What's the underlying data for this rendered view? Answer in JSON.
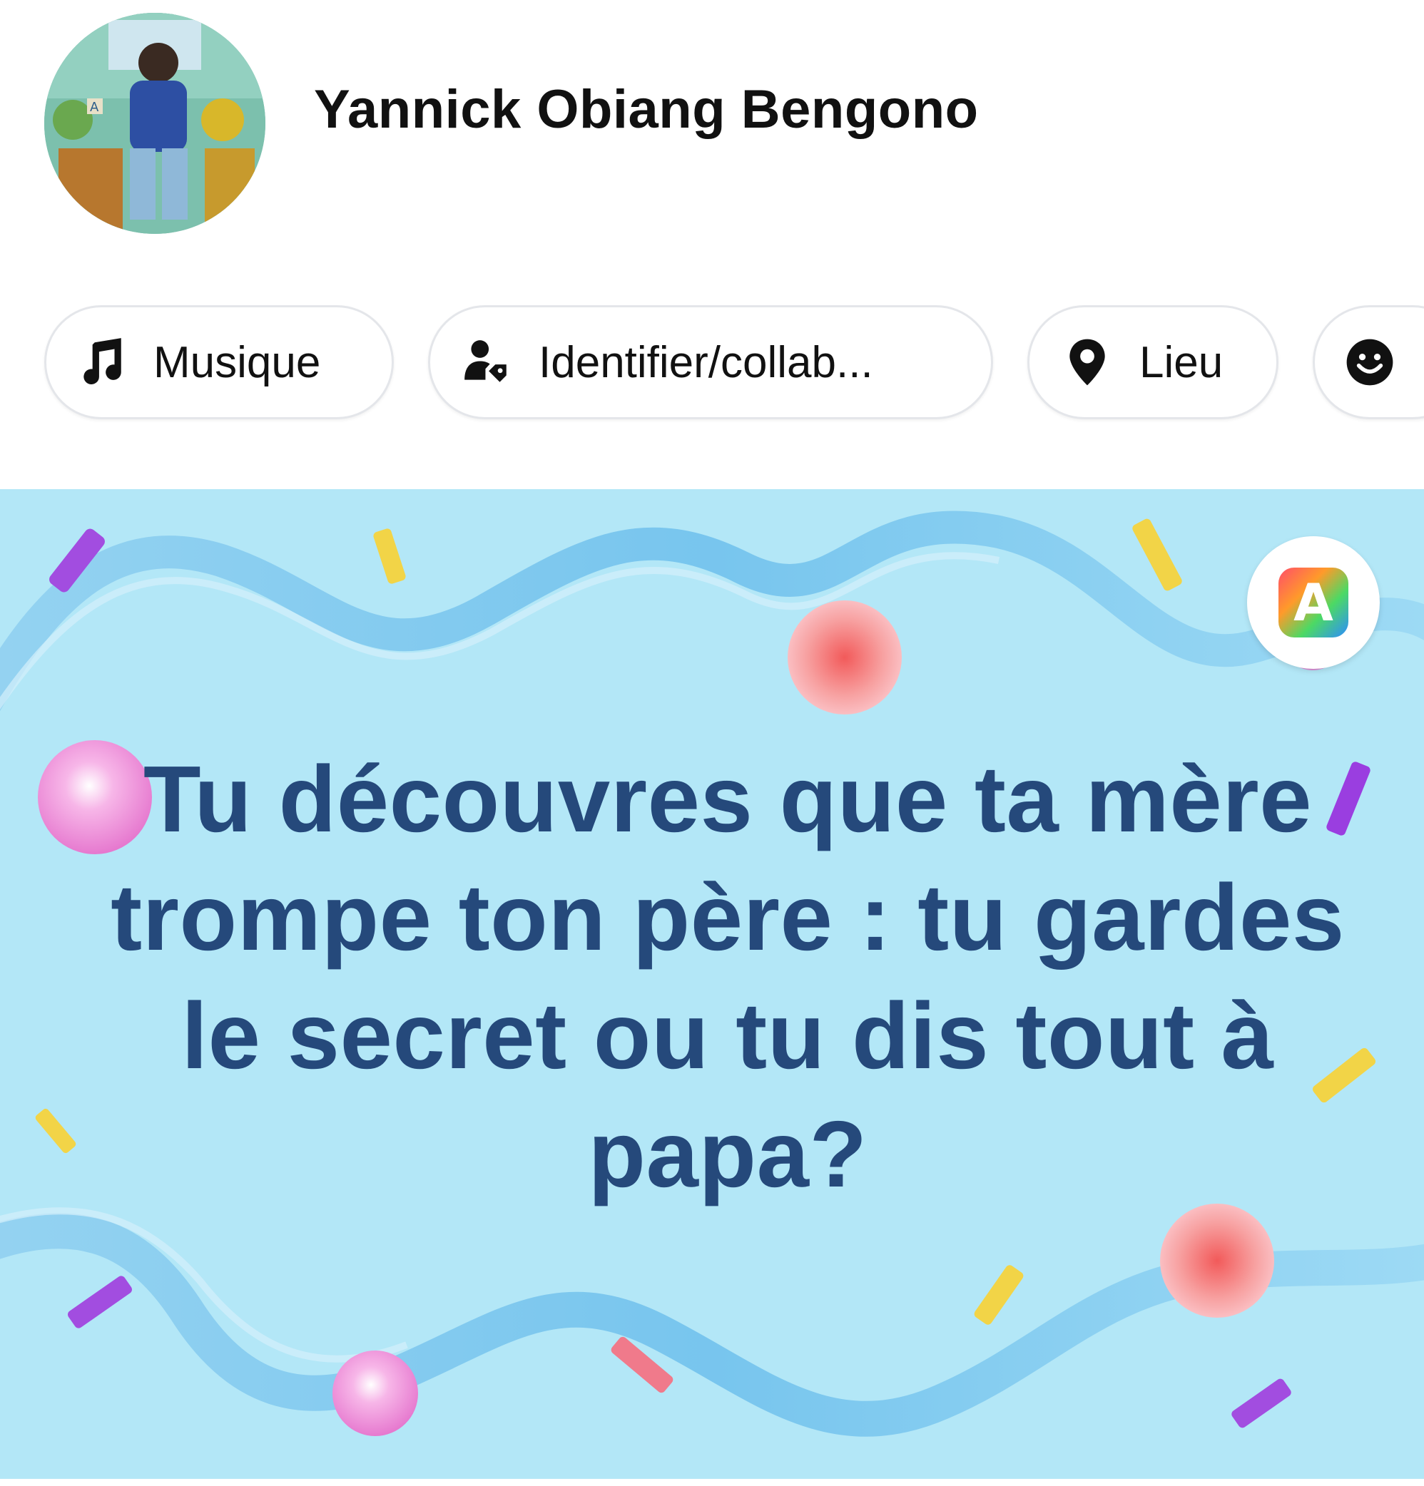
{
  "composer": {
    "author_name": "Yannick Obiang Bengono",
    "chips": {
      "music": "Musique",
      "tag": "Identifier/collab...",
      "location": "Lieu"
    }
  },
  "post": {
    "text": "Tu découvres que ta mère trompe ton père  : tu gardes le secret ou tu dis tout à papa?",
    "background_color": "#b3e7f7",
    "text_color": "#25497b",
    "font_button_glyph": "A"
  },
  "icons": [
    "music-note-icon",
    "person-tag-icon",
    "location-pin-icon",
    "smiley-icon",
    "font-style-icon"
  ]
}
